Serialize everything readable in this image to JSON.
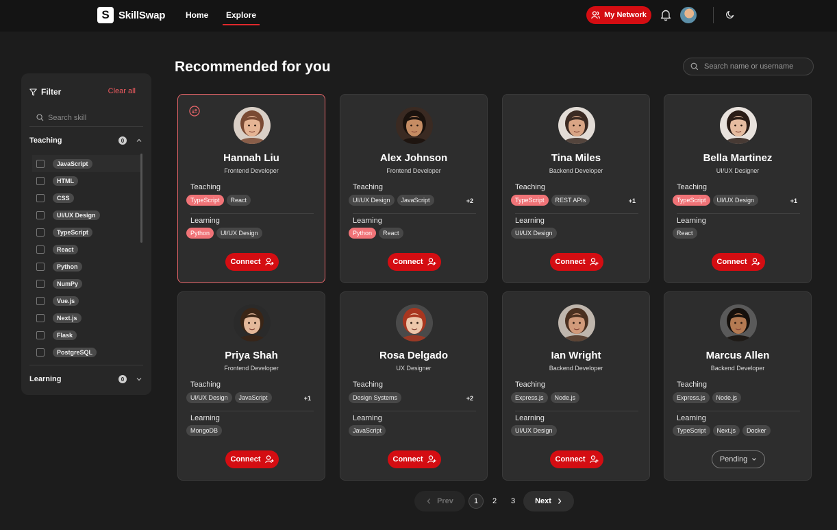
{
  "brand": {
    "logo_letter": "S",
    "name": "SkillSwap"
  },
  "nav": {
    "links": [
      "Home",
      "Explore"
    ],
    "active": "Explore",
    "my_network": "My Network"
  },
  "sidebar": {
    "title": "Filter",
    "clear_all": "Clear all",
    "search_placeholder": "Search skill",
    "teaching": {
      "label": "Teaching",
      "count": "0"
    },
    "learning": {
      "label": "Learning",
      "count": "0"
    },
    "skills": [
      "JavaScript",
      "HTML",
      "CSS",
      "UI/UX Design",
      "TypeScript",
      "React",
      "Python",
      "NumPy",
      "Vue.js",
      "Next.js",
      "Flask",
      "PostgreSQL"
    ]
  },
  "main": {
    "title": "Recommended for you",
    "search_placeholder": "Search name or username",
    "teaching_label": "Teaching",
    "learning_label": "Learning",
    "connect_label": "Connect",
    "pending_label": "Pending"
  },
  "people": [
    {
      "name": "Hannah Liu",
      "role": "Frontend Developer",
      "teaching": [
        {
          "t": "TypeScript",
          "hot": true
        },
        {
          "t": "React",
          "hot": false
        }
      ],
      "teaching_more": "",
      "learning": [
        {
          "t": "Python",
          "hot": true
        },
        {
          "t": "UI/UX Design",
          "hot": false
        }
      ],
      "learning_more": ""
    },
    {
      "name": "Alex Johnson",
      "role": "Frontend Developer",
      "teaching": [
        {
          "t": "UI/UX Design",
          "hot": false
        },
        {
          "t": "JavaScript",
          "hot": false
        }
      ],
      "teaching_more": "+2",
      "learning": [
        {
          "t": "Python",
          "hot": true
        },
        {
          "t": "React",
          "hot": false
        }
      ],
      "learning_more": ""
    },
    {
      "name": "Tina Miles",
      "role": "Backend Developer",
      "teaching": [
        {
          "t": "TypeScript",
          "hot": true
        },
        {
          "t": "REST APIs",
          "hot": false
        }
      ],
      "teaching_more": "+1",
      "learning": [
        {
          "t": "UI/UX Design",
          "hot": false
        }
      ],
      "learning_more": ""
    },
    {
      "name": "Bella Martinez",
      "role": "UI/UX Designer",
      "teaching": [
        {
          "t": "TypeScript",
          "hot": true
        },
        {
          "t": "UI/UX Design",
          "hot": false
        }
      ],
      "teaching_more": "+1",
      "learning": [
        {
          "t": "React",
          "hot": false
        }
      ],
      "learning_more": ""
    },
    {
      "name": "Priya Shah",
      "role": "Frontend Developer",
      "teaching": [
        {
          "t": "UI/UX Design",
          "hot": false
        },
        {
          "t": "JavaScript",
          "hot": false
        }
      ],
      "teaching_more": "+1",
      "learning": [
        {
          "t": "MongoDB",
          "hot": false
        }
      ],
      "learning_more": ""
    },
    {
      "name": "Rosa Delgado",
      "role": "UX Designer",
      "teaching": [
        {
          "t": "Design Systems",
          "hot": false
        }
      ],
      "teaching_more": "+2",
      "learning": [
        {
          "t": "JavaScript",
          "hot": false
        }
      ],
      "learning_more": ""
    },
    {
      "name": "Ian Wright",
      "role": "Backend Developer",
      "teaching": [
        {
          "t": "Express.js",
          "hot": false
        },
        {
          "t": "Node.js",
          "hot": false
        }
      ],
      "teaching_more": "",
      "learning": [
        {
          "t": "UI/UX Design",
          "hot": false
        }
      ],
      "learning_more": ""
    },
    {
      "name": "Marcus Allen",
      "role": "Backend Developer",
      "teaching": [
        {
          "t": "Express.js",
          "hot": false
        },
        {
          "t": "Node.js",
          "hot": false
        }
      ],
      "teaching_more": "",
      "learning": [
        {
          "t": "TypeScript",
          "hot": false
        },
        {
          "t": "Next.js",
          "hot": false
        },
        {
          "t": "Docker",
          "hot": false
        }
      ],
      "learning_more": "",
      "status": "pending"
    }
  ],
  "pagination": {
    "prev": "Prev",
    "next": "Next",
    "pages": [
      "1",
      "2",
      "3"
    ],
    "current": "1"
  },
  "colors": {
    "accent": "#d40d12",
    "chip_hot": "#f07377",
    "bg": "#1c1c1c",
    "card": "#2d2d2d"
  }
}
